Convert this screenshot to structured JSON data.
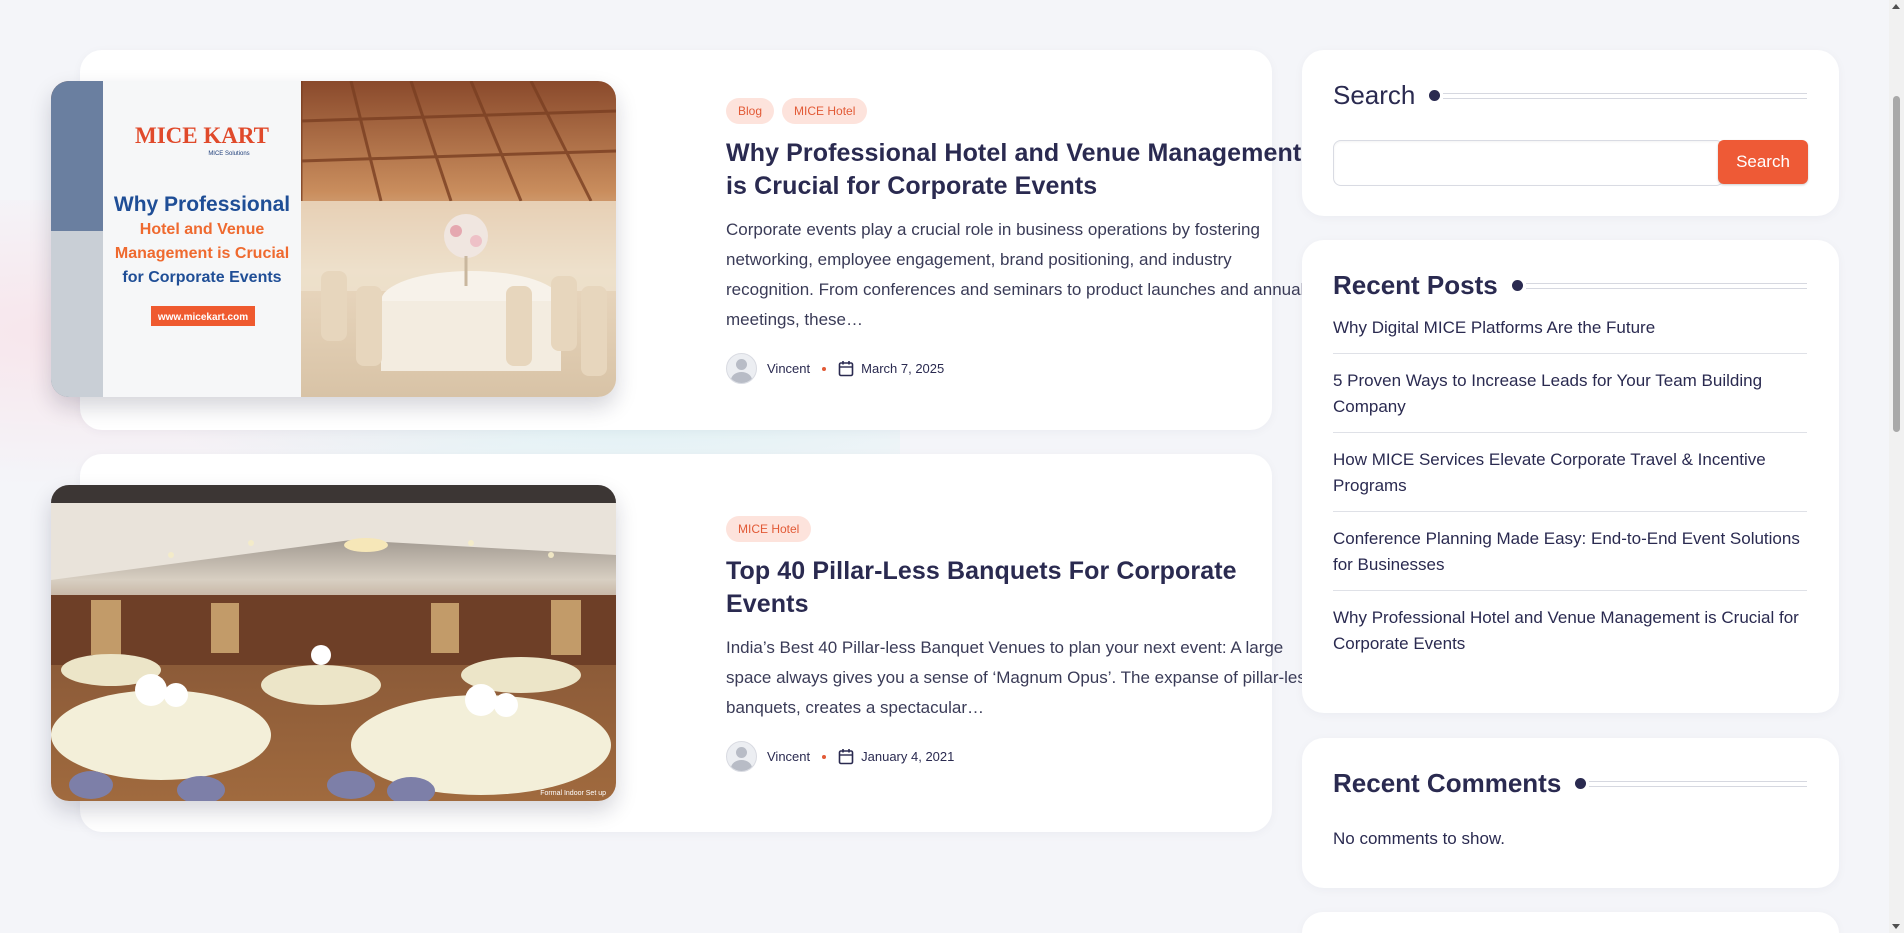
{
  "posts": [
    {
      "tags": [
        "Blog",
        "MICE Hotel"
      ],
      "title": "Why Professional Hotel and Venue Management is Crucial for Corporate Events",
      "excerpt": "Corporate events play a crucial role in business operations by fostering networking, employee engagement, brand positioning, and industry recognition. From conferences and seminars to product launches and annual meetings, these…",
      "author": "Vincent",
      "date": "March 7, 2025",
      "image": {
        "logo": "MICE KART",
        "logo_sub": "MICE Solutions",
        "headline_1": "Why Professional",
        "headline_2": "Hotel and Venue Management is Crucial",
        "headline_3": "for Corporate Events",
        "url": "www.micekart.com"
      }
    },
    {
      "tags": [
        "MICE Hotel"
      ],
      "title": "Top 40 Pillar-Less Banquets For Corporate Events",
      "excerpt": "India’s Best 40 Pillar-less Banquet Venues to plan your next event: A large space always gives you a sense of ‘Magnum Opus’. The expanse of pillar-less banquets, creates a spectacular…",
      "author": "Vincent",
      "date": "January 4, 2021",
      "image": {
        "caption": "Formal Indoor Set up"
      }
    }
  ],
  "sidebar": {
    "search": {
      "title": "Search",
      "button": "Search",
      "value": ""
    },
    "recent_posts": {
      "title": "Recent Posts",
      "items": [
        "Why Digital MICE Platforms Are the Future",
        "5 Proven Ways to Increase Leads for Your Team Building Company",
        "How MICE Services Elevate Corporate Travel & Incentive Programs",
        "Conference Planning Made Easy: End-to-End Event Solutions for Businesses",
        "Why Professional Hotel and Venue Management is Crucial for Corporate Events"
      ]
    },
    "recent_comments": {
      "title": "Recent Comments",
      "empty_text": "No comments to show."
    }
  },
  "colors": {
    "accent": "#ee5a36",
    "heading": "#2a2a50",
    "tag_bg": "#fde3dc",
    "background": "#f4f5f9"
  },
  "icons": [
    "user-avatar-icon",
    "calendar-icon"
  ]
}
